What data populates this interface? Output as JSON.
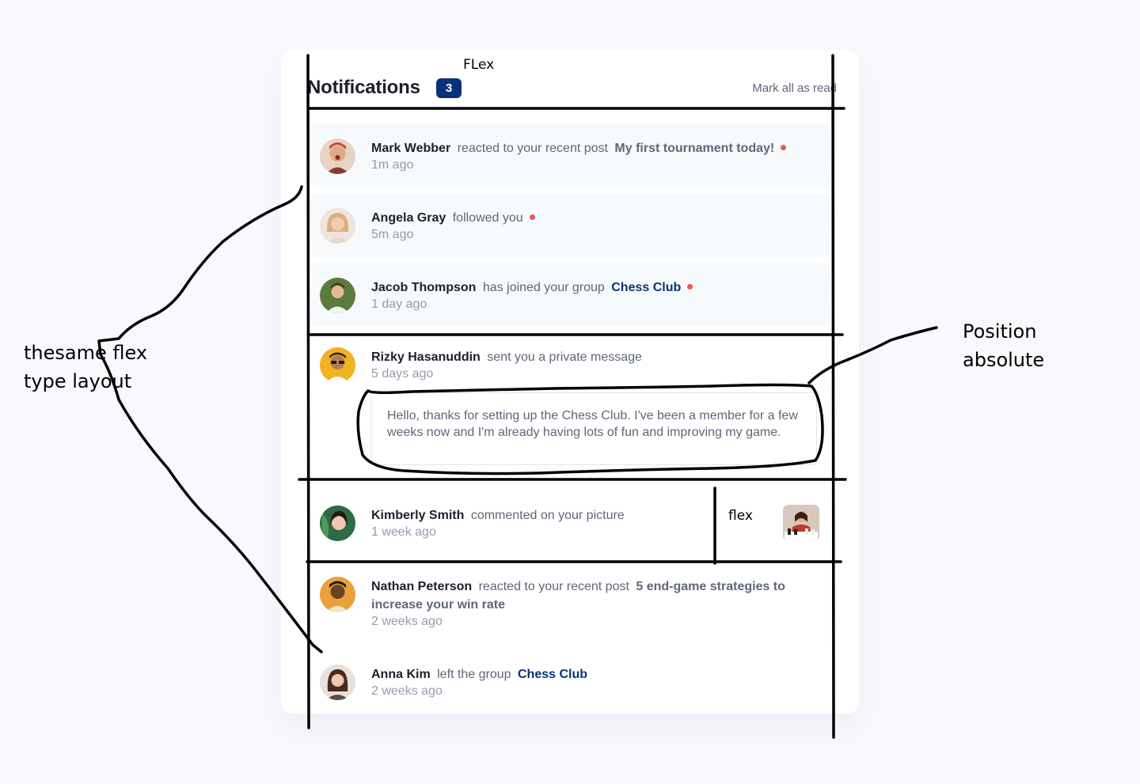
{
  "header": {
    "title": "Notifications",
    "count": "3",
    "mark_all": "Mark all as read"
  },
  "notifications": [
    {
      "name": "Mark Webber",
      "action": "reacted to your recent post",
      "post": "My first tournament today!",
      "time": "1m ago",
      "unread": true
    },
    {
      "name": "Angela Gray",
      "action": "followed you",
      "time": "5m ago",
      "unread": true
    },
    {
      "name": "Jacob Thompson",
      "action": "has joined your group",
      "group": "Chess Club",
      "time": "1 day ago",
      "unread": true
    },
    {
      "name": "Rizky Hasanuddin",
      "action": "sent you a private message",
      "time": "5 days ago",
      "message": "Hello, thanks for setting up the Chess Club. I've been a member for a few weeks now and I'm already having lots of fun and improving my game.",
      "unread": false
    },
    {
      "name": "Kimberly Smith",
      "action": "commented on your picture",
      "time": "1 week ago",
      "unread": false
    },
    {
      "name": "Nathan Peterson",
      "action": "reacted to your recent post",
      "post": "5 end-game strategies to increase your win rate",
      "time": "2 weeks ago",
      "unread": false
    },
    {
      "name": "Anna Kim",
      "action": "left the group",
      "group": "Chess Club",
      "time": "2 weeks ago",
      "unread": false
    }
  ],
  "annotations": {
    "flex_top": "FLex",
    "same_layout": [
      "thesame flex",
      "type layout"
    ],
    "position_absolute": [
      "Position",
      "absolute"
    ],
    "flex_inner": "flex"
  },
  "colors": {
    "navy": "#0a327b",
    "red_dot": "#f65552",
    "unread_bg": "#f7fafd",
    "text_dark": "#1c202b",
    "text_gray": "#5e6778",
    "text_light": "#939cad"
  },
  "icons": [
    "avatar-mark-webber",
    "avatar-angela-gray",
    "avatar-jacob-thompson",
    "avatar-rizky-hasanuddin",
    "avatar-kimberly-smith",
    "avatar-nathan-peterson",
    "avatar-anna-kim",
    "chess-picture-thumbnail"
  ]
}
